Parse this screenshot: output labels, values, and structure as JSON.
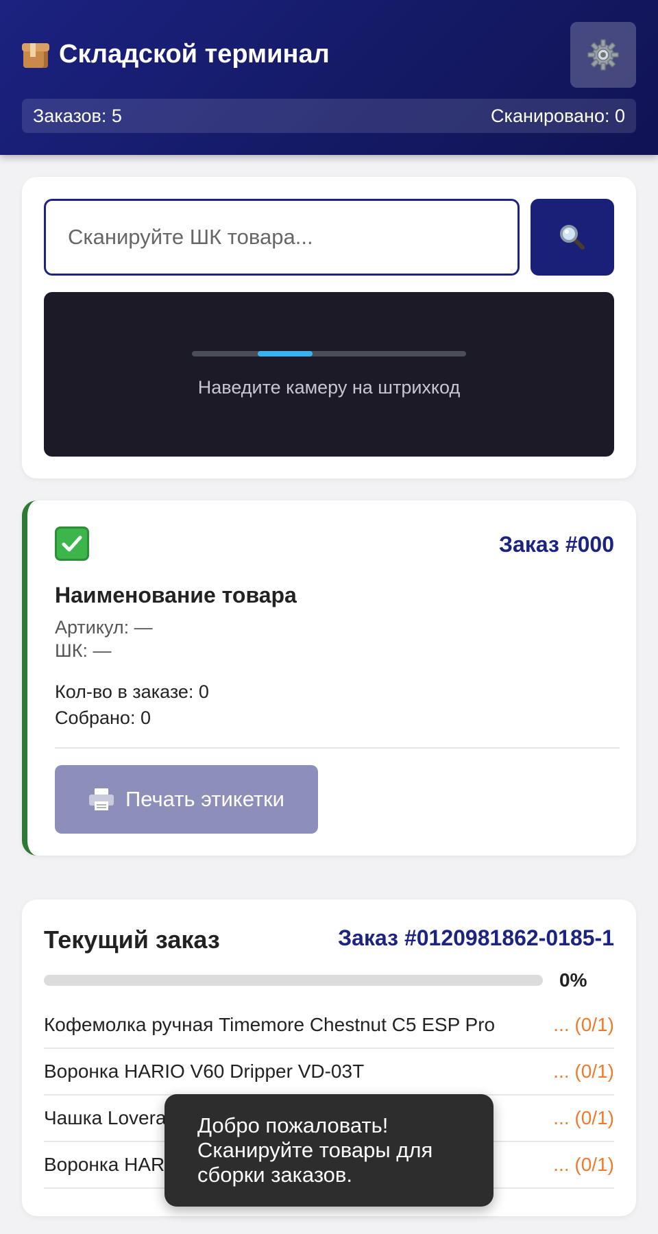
{
  "header": {
    "icon": "package-icon",
    "title": "Складской терминал",
    "settings_icon": "gear-icon",
    "orders_label": "Заказов: 5",
    "scanned_label": "Сканировано: 0"
  },
  "scanner": {
    "input_placeholder": "Сканируйте ШК товара...",
    "input_value": "",
    "search_icon": "magnifier-icon",
    "camera_hint": "Наведите камеру на штрихкод"
  },
  "product": {
    "status_icon": "check-mark-icon",
    "order_number": "Заказ #000",
    "name": "Наименование товара",
    "article": "Артикул: —",
    "barcode": "ШК: —",
    "ordered_qty": "Кол-во в заказе: 0",
    "picked_qty": "Собрано: 0",
    "print_icon": "printer-icon",
    "print_label": "Печать этикетки"
  },
  "current_order": {
    "title": "Текущий заказ",
    "order_ref": "Заказ #0120981862-0185-1",
    "progress": 0,
    "progress_label": "0%",
    "items": [
      {
        "name": "Кофемолка ручная Timemore Chestnut C5 ESP Pro",
        "status": "... (0/1)"
      },
      {
        "name": "Воронка HARIO V60 Dripper VD-03T",
        "status": "... (0/1)"
      },
      {
        "name": "Чашка Lovera",
        "status": "... (0/1)"
      },
      {
        "name": "Воронка HAR",
        "status": "... (0/1)"
      }
    ]
  },
  "toast": {
    "message": "Добро пожаловать! Сканируйте товары для сборки заказов."
  },
  "colors": {
    "header_bg": "#1b2280",
    "accent": "#1c2380",
    "success": "#2c7a33",
    "pending": "#f07a2a",
    "camera_bg": "#1b1a26",
    "scan_line": "#39b2ef"
  }
}
